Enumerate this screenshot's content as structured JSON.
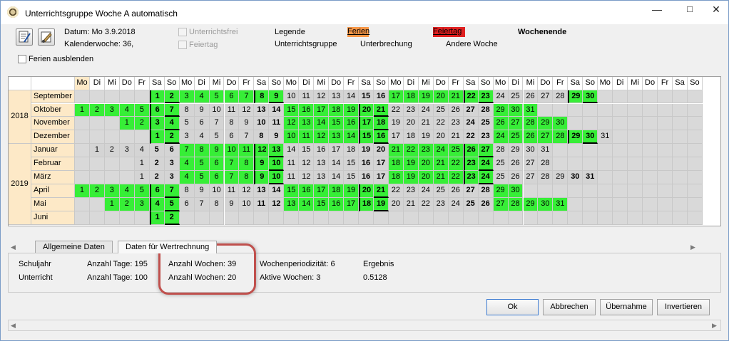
{
  "window": {
    "title": "Unterrichtsgruppe Woche A automatisch"
  },
  "header": {
    "date_label": "Datum: Mo 3.9.2018",
    "week_label": "Kalenderwoche: 36,",
    "cb_unterrichtsfrei": "Unterrichtsfrei",
    "cb_feiertag": "Feiertag",
    "cb_ferien_ausblenden": "Ferien ausblenden",
    "legend_title": "Legende",
    "legend_ferien": "Ferien",
    "legend_feiertag": "Feiertag",
    "legend_wochenende": "Wochenende",
    "legend_unterrichtsgruppe": "Unterrichtsgruppe",
    "legend_unterbrechung": "Unterbrechung",
    "legend_andere_woche": "Andere Woche"
  },
  "colors": {
    "ferien": "#f79646",
    "feiertag": "#e02020",
    "green": "#37ee37",
    "gray": "#d4d4d4",
    "month_bg": "#fde9c7"
  },
  "calendar": {
    "day_headers": [
      "Mo",
      "Di",
      "Mi",
      "Do",
      "Fr",
      "Sa",
      "So",
      "Mo",
      "Di",
      "Mi",
      "Do",
      "Fr",
      "Sa",
      "So",
      "Mo",
      "Di",
      "Mi",
      "Do",
      "Fr",
      "Sa",
      "So",
      "Mo",
      "Di",
      "Mi",
      "Do",
      "Fr",
      "Sa",
      "So",
      "Mo",
      "Di",
      "Mi",
      "Do",
      "Fr",
      "Sa",
      "So",
      "Mo",
      "Di",
      "Mi",
      "Do",
      "Fr",
      "Sa",
      "So"
    ],
    "years": [
      {
        "label": "2018"
      },
      {
        "label": "2019"
      }
    ],
    "months": [
      {
        "name": "September",
        "start": 6,
        "days": 30,
        "green_ranges": [
          [
            1,
            9
          ],
          [
            17,
            23
          ],
          [
            29,
            30
          ]
        ],
        "bold_end": 30
      },
      {
        "name": "Oktober",
        "start": 1,
        "days": 31,
        "green_ranges": [
          [
            1,
            7
          ],
          [
            15,
            21
          ],
          [
            29,
            31
          ]
        ],
        "bold_end": 0
      },
      {
        "name": "November",
        "start": 4,
        "days": 30,
        "green_ranges": [
          [
            1,
            4
          ],
          [
            12,
            18
          ],
          [
            26,
            30
          ]
        ],
        "bold_end": 0
      },
      {
        "name": "Dezember",
        "start": 6,
        "days": 31,
        "green_ranges": [
          [
            1,
            2
          ],
          [
            10,
            16
          ],
          [
            24,
            30
          ]
        ],
        "bold_end": 0
      },
      {
        "name": "Januar",
        "start": 2,
        "days": 31,
        "green_ranges": [
          [
            7,
            13
          ],
          [
            21,
            27
          ]
        ],
        "bold_end": 0
      },
      {
        "name": "Februar",
        "start": 5,
        "days": 28,
        "green_ranges": [
          [
            4,
            10
          ],
          [
            18,
            24
          ]
        ],
        "bold_end": 0
      },
      {
        "name": "März",
        "start": 5,
        "days": 31,
        "green_ranges": [
          [
            4,
            10
          ],
          [
            18,
            24
          ]
        ],
        "bold_end": 31
      },
      {
        "name": "April",
        "start": 1,
        "days": 30,
        "green_ranges": [
          [
            1,
            7
          ],
          [
            15,
            21
          ],
          [
            29,
            30
          ]
        ],
        "bold_end": 0
      },
      {
        "name": "Mai",
        "start": 3,
        "days": 31,
        "green_ranges": [
          [
            1,
            5
          ],
          [
            13,
            19
          ],
          [
            27,
            31
          ]
        ],
        "bold_end": 0
      },
      {
        "name": "Juni",
        "start": 6,
        "days": 2,
        "green_ranges": [
          [
            1,
            2
          ]
        ],
        "bold_end": 0
      }
    ]
  },
  "tabs": [
    {
      "label": "Allgemeine Daten",
      "active": false
    },
    {
      "label": "Daten für Wertrechnung",
      "active": true
    }
  ],
  "stats": {
    "schuljahr_label": "Schuljahr",
    "unterricht_label": "Unterricht",
    "tage_sj": "Anzahl Tage: 195",
    "tage_u": "Anzahl Tage: 100",
    "wochen_sj": "Anzahl Wochen: 39",
    "wochen_u": "Anzahl Wochen: 20",
    "periodizitaet": "Wochenperiodizität: 6",
    "aktive_wochen": "Aktive Wochen: 3",
    "ergebnis_label": "Ergebnis",
    "ergebnis_value": "0.5128"
  },
  "buttons": {
    "ok": "Ok",
    "abbrechen": "Abbrechen",
    "uebernahme": "Übernahme",
    "invertieren": "Invertieren"
  }
}
